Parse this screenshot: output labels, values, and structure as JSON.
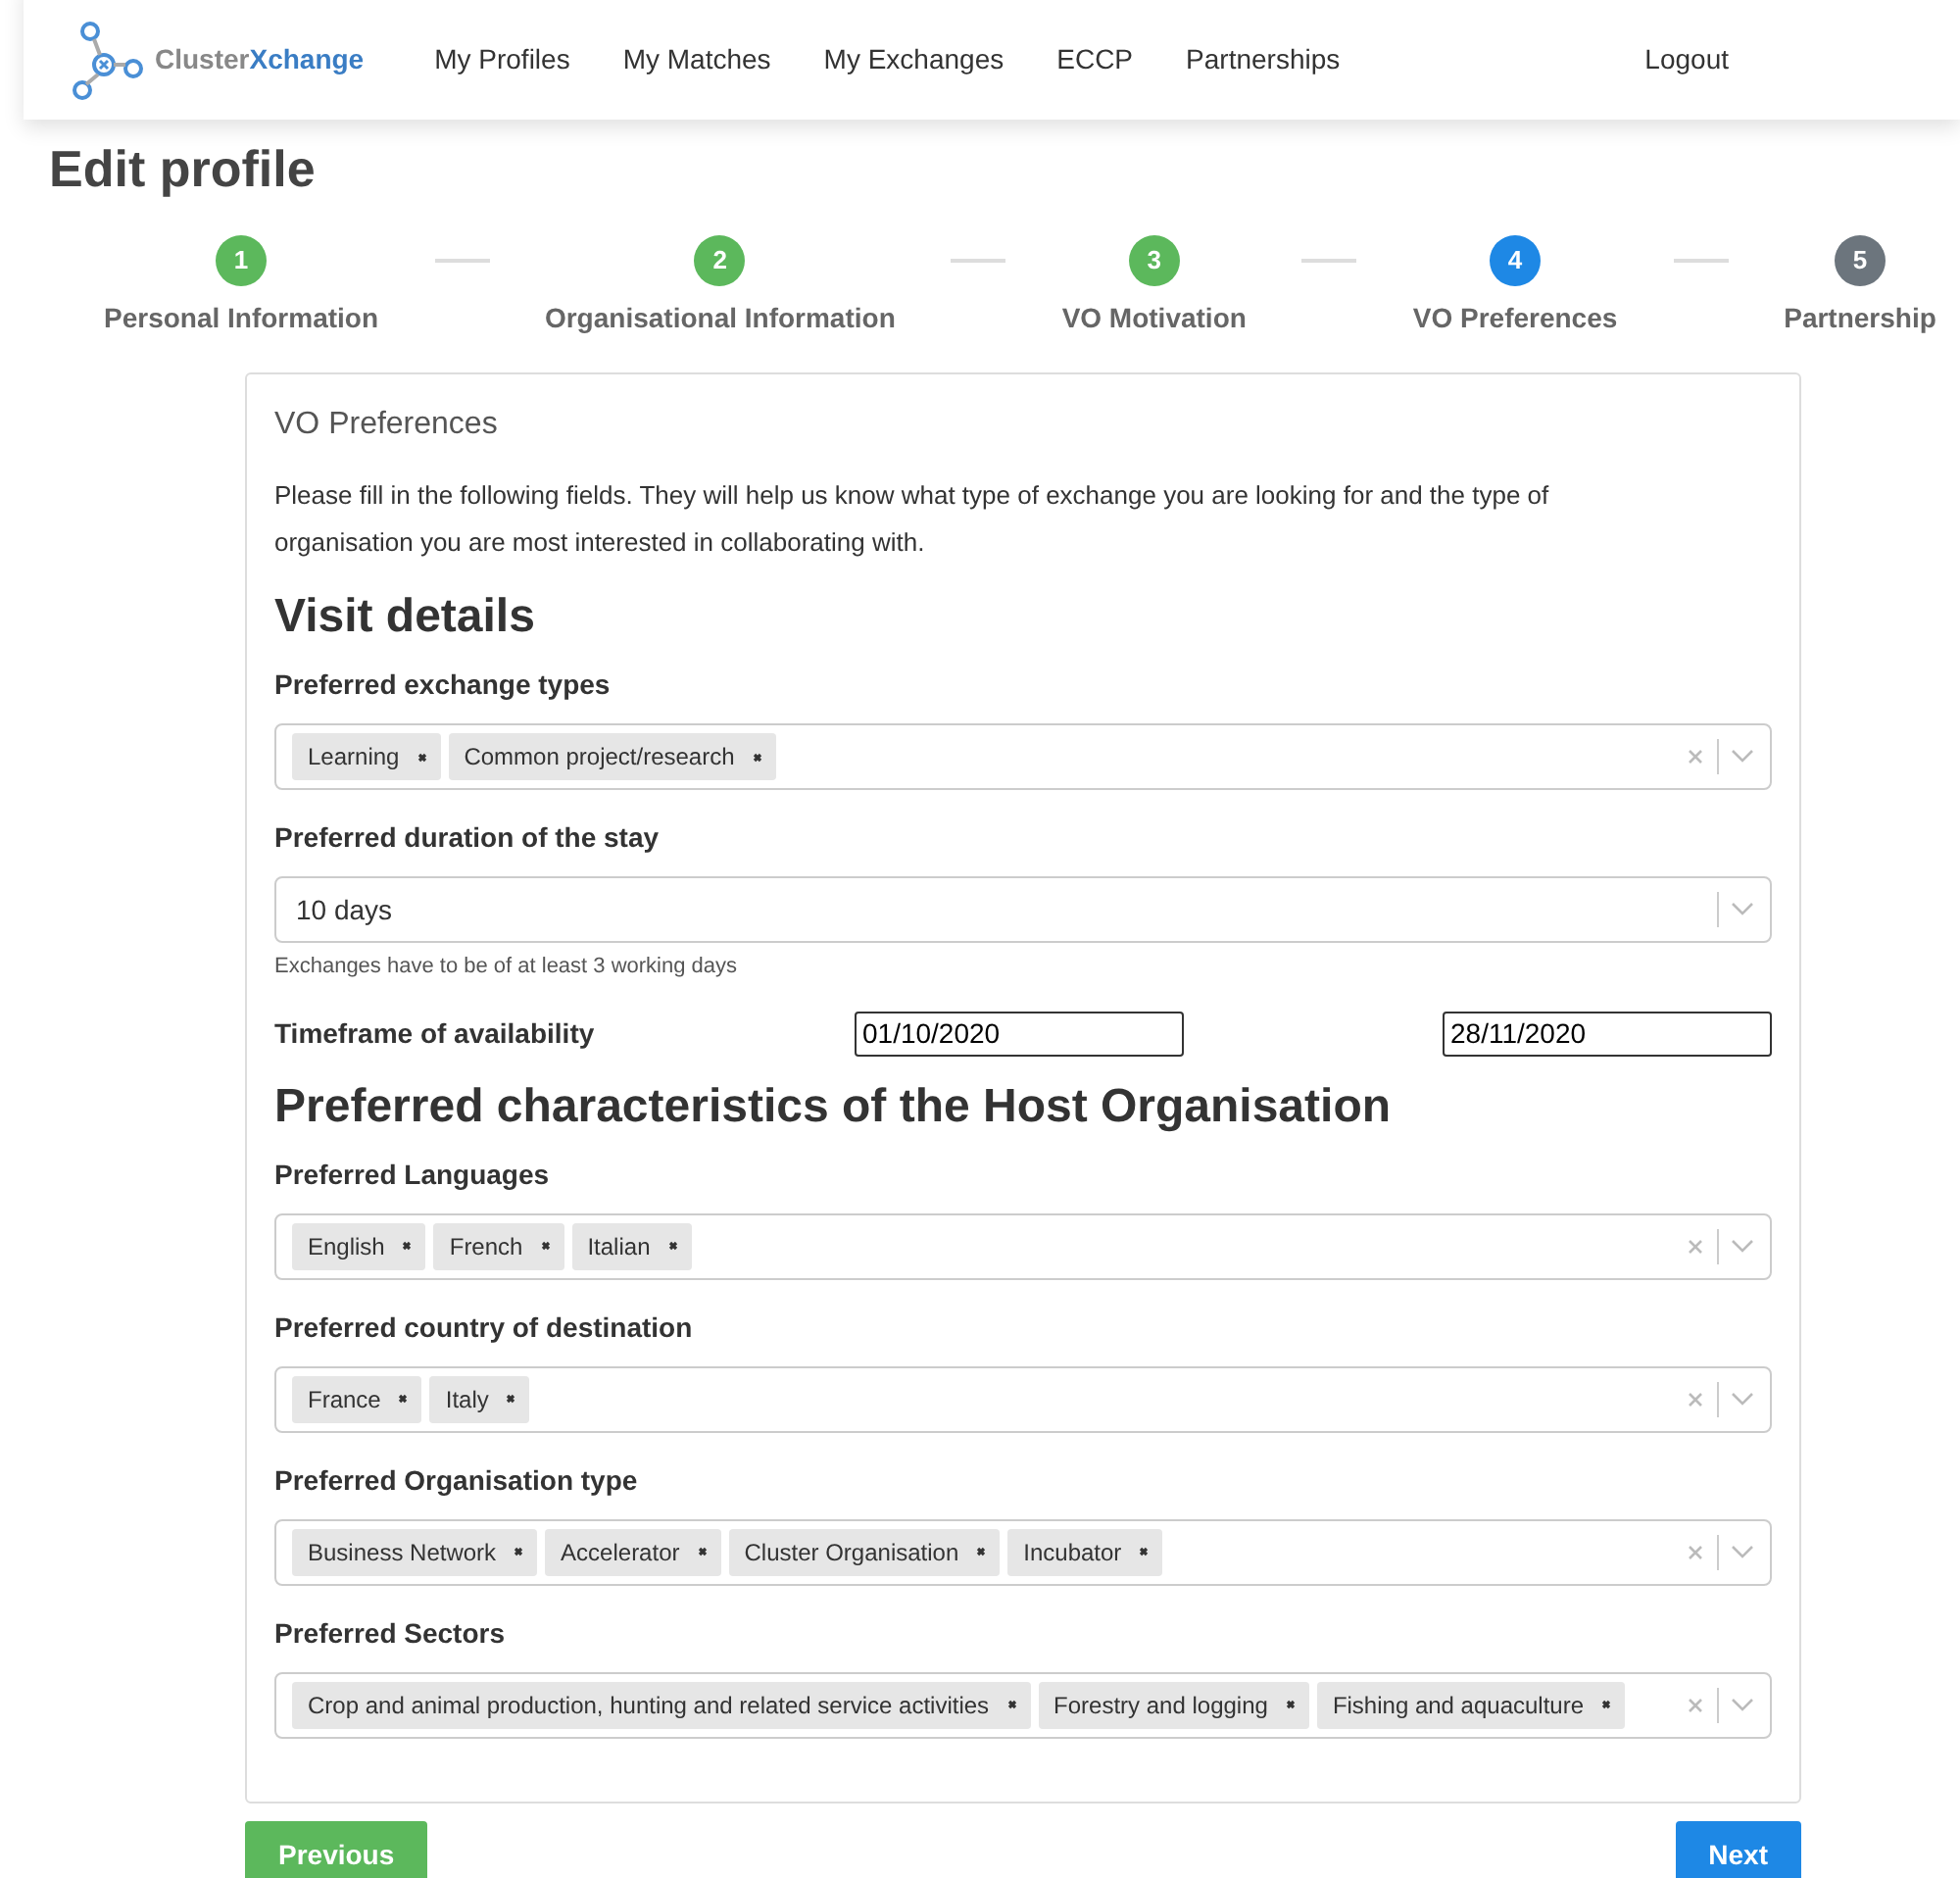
{
  "navbar": {
    "logo": {
      "text_plain": "Cluster",
      "text_accent": "Xchange"
    },
    "links": [
      "My Profiles",
      "My Matches",
      "My Exchanges",
      "ECCP",
      "Partnerships"
    ],
    "logout": "Logout"
  },
  "page_title": "Edit profile",
  "steps": [
    {
      "number": "1",
      "label": "Personal Information",
      "color": "#5cb85c"
    },
    {
      "number": "2",
      "label": "Organisational Information",
      "color": "#5cb85c"
    },
    {
      "number": "3",
      "label": "VO Motivation",
      "color": "#5cb85c"
    },
    {
      "number": "4",
      "label": "VO Preferences",
      "color": "#1e88e5"
    },
    {
      "number": "5",
      "label": "Partnership",
      "color": "#6c757d"
    }
  ],
  "card": {
    "title": "VO Preferences",
    "intro": "Please fill in the following fields. They will help us know what type of exchange you are looking for and the type of organisation you are most interested in collaborating with.",
    "sections": [
      {
        "heading": "Visit details",
        "fields": [
          {
            "kind": "multiselect",
            "label": "Preferred exchange types",
            "tags": [
              "Learning",
              "Common project/research"
            ]
          },
          {
            "kind": "select",
            "label": "Preferred duration of the stay",
            "value": "10 days",
            "help": "Exchanges have to be of at least 3 working days"
          },
          {
            "kind": "daterange",
            "label": "Timeframe of availability",
            "from": "01/10/2020",
            "to": "28/11/2020"
          }
        ]
      },
      {
        "heading": "Preferred characteristics of the Host Organisation",
        "fields": [
          {
            "kind": "multiselect",
            "label": "Preferred Languages",
            "tags": [
              "English",
              "French",
              "Italian"
            ]
          },
          {
            "kind": "multiselect",
            "label": "Preferred country of destination",
            "tags": [
              "France",
              "Italy"
            ]
          },
          {
            "kind": "multiselect",
            "label": "Preferred Organisation type",
            "tags": [
              "Business Network",
              "Accelerator",
              "Cluster Organisation",
              "Incubator"
            ]
          },
          {
            "kind": "multiselect",
            "label": "Preferred Sectors",
            "tags": [
              "Crop and animal production, hunting and related service activities",
              "Forestry and logging",
              "Fishing and aquaculture"
            ]
          }
        ]
      }
    ]
  },
  "buttons": {
    "previous": "Previous",
    "next": "Next"
  }
}
